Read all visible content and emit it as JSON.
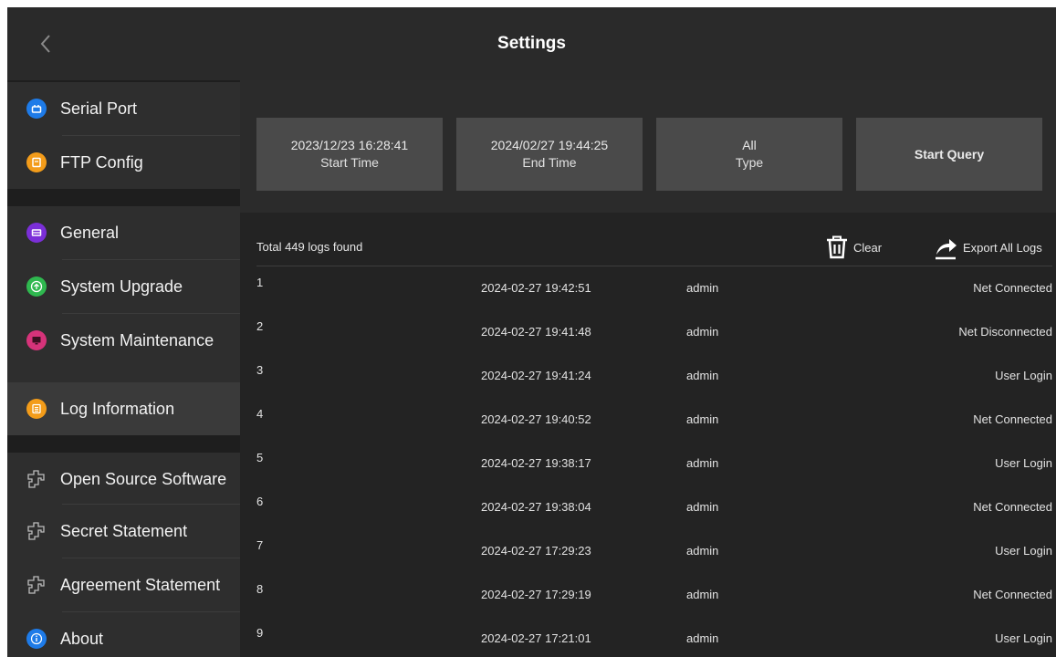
{
  "header": {
    "title": "Settings"
  },
  "sidebar": {
    "items": [
      {
        "label": "Serial Port",
        "icon": "serial-port-icon",
        "color": "#1e7be8"
      },
      {
        "label": "FTP Config",
        "icon": "ftp-icon",
        "color": "#f39c1a"
      },
      {
        "label": "General",
        "icon": "general-icon",
        "color": "#7b2fd8"
      },
      {
        "label": "System Upgrade",
        "icon": "upgrade-icon",
        "color": "#2fb84f"
      },
      {
        "label": "System Maintenance",
        "icon": "maintenance-icon",
        "color": "#d6337a"
      },
      {
        "label": "Log Information",
        "icon": "log-icon",
        "color": "#f39c1a"
      },
      {
        "label": "Open Source Software",
        "icon": "puzzle-icon"
      },
      {
        "label": "Secret Statement",
        "icon": "puzzle-icon"
      },
      {
        "label": "Agreement Statement",
        "icon": "puzzle-icon"
      },
      {
        "label": "About",
        "icon": "info-icon",
        "color": "#1e7be8"
      }
    ]
  },
  "query": {
    "start_value": "2023/12/23 16:28:41",
    "start_label": "Start Time",
    "end_value": "2024/02/27 19:44:25",
    "end_label": "End Time",
    "type_value": "All",
    "type_label": "Type",
    "start_query": "Start Query"
  },
  "list": {
    "total": "Total 449 logs found",
    "clear": "Clear",
    "export": "Export All Logs",
    "rows": [
      {
        "idx": "1",
        "time": "2024-02-27 19:42:51",
        "user": "admin",
        "event": "Net Connected"
      },
      {
        "idx": "2",
        "time": "2024-02-27 19:41:48",
        "user": "admin",
        "event": "Net Disconnected"
      },
      {
        "idx": "3",
        "time": "2024-02-27 19:41:24",
        "user": "admin",
        "event": "User Login"
      },
      {
        "idx": "4",
        "time": "2024-02-27 19:40:52",
        "user": "admin",
        "event": "Net Connected"
      },
      {
        "idx": "5",
        "time": "2024-02-27 19:38:17",
        "user": "admin",
        "event": "User Login"
      },
      {
        "idx": "6",
        "time": "2024-02-27 19:38:04",
        "user": "admin",
        "event": "Net Connected"
      },
      {
        "idx": "7",
        "time": "2024-02-27 17:29:23",
        "user": "admin",
        "event": "User Login"
      },
      {
        "idx": "8",
        "time": "2024-02-27 17:29:19",
        "user": "admin",
        "event": "Net Connected"
      },
      {
        "idx": "9",
        "time": "2024-02-27 17:21:01",
        "user": "admin",
        "event": "User Login"
      }
    ]
  }
}
